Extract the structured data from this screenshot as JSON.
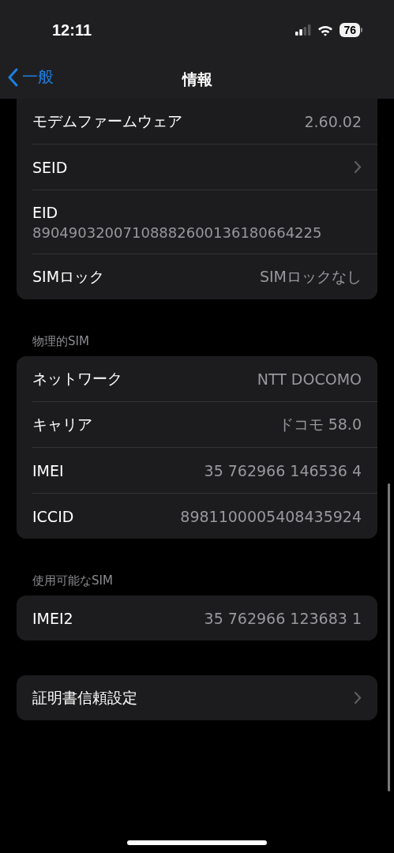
{
  "status_bar": {
    "time": "12:11",
    "battery": "76"
  },
  "nav": {
    "back": "一般",
    "title": "情報"
  },
  "sections": [
    {
      "rows": [
        {
          "kind": "value",
          "label": "モデムファームウェア",
          "value": "2.60.02"
        },
        {
          "kind": "link",
          "label": "SEID"
        },
        {
          "kind": "stacked",
          "label": "EID",
          "value": "89049032007108882600136180664225"
        },
        {
          "kind": "value",
          "label": "SIMロック",
          "value": "SIMロックなし"
        }
      ]
    },
    {
      "header": "物理的SIM",
      "rows": [
        {
          "kind": "value",
          "label": "ネットワーク",
          "value": "NTT DOCOMO"
        },
        {
          "kind": "value",
          "label": "キャリア",
          "value": "ドコモ 58.0"
        },
        {
          "kind": "value",
          "label": "IMEI",
          "value": "35 762966 146536 4"
        },
        {
          "kind": "value",
          "label": "ICCID",
          "value": "8981100005408435924"
        }
      ]
    },
    {
      "header": "使用可能なSIM",
      "rows": [
        {
          "kind": "value",
          "label": "IMEI2",
          "value": "35 762966 123683 1"
        }
      ]
    },
    {
      "rows": [
        {
          "kind": "link",
          "label": "証明書信頼設定"
        }
      ]
    }
  ]
}
